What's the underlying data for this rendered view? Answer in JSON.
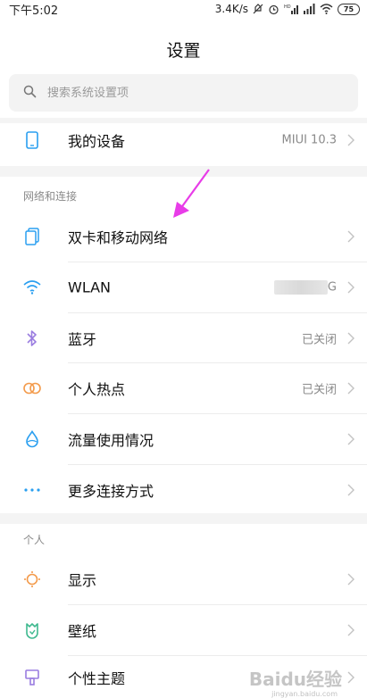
{
  "status_bar": {
    "time": "下午5:02",
    "speed": "3.4K/s",
    "battery": "75"
  },
  "header": {
    "title": "设置"
  },
  "search": {
    "placeholder": "搜索系统设置项"
  },
  "device_row": {
    "label": "我的设备",
    "value": "MIUI 10.3"
  },
  "network_section": {
    "title": "网络和连接",
    "items": [
      {
        "label": "双卡和移动网络",
        "value": "",
        "icon": "sim-card-icon"
      },
      {
        "label": "WLAN",
        "value": "G",
        "icon": "wifi-icon"
      },
      {
        "label": "蓝牙",
        "value": "已关闭",
        "icon": "bluetooth-icon"
      },
      {
        "label": "个人热点",
        "value": "已关闭",
        "icon": "hotspot-icon"
      },
      {
        "label": "流量使用情况",
        "value": "",
        "icon": "data-usage-icon"
      },
      {
        "label": "更多连接方式",
        "value": "",
        "icon": "more-connections-icon"
      }
    ]
  },
  "personal_section": {
    "title": "个人",
    "items": [
      {
        "label": "显示",
        "icon": "display-icon"
      },
      {
        "label": "壁纸",
        "icon": "wallpaper-icon"
      },
      {
        "label": "个性主题",
        "icon": "theme-icon"
      }
    ]
  },
  "colors": {
    "accent_blue": "#2a9ff0",
    "accent_purple": "#9a7de0",
    "accent_orange": "#f39a4a",
    "annotation_arrow": "#e83ce8"
  },
  "watermark": {
    "brand": "Baidu经验",
    "site": "jingyan.baidu.com"
  }
}
